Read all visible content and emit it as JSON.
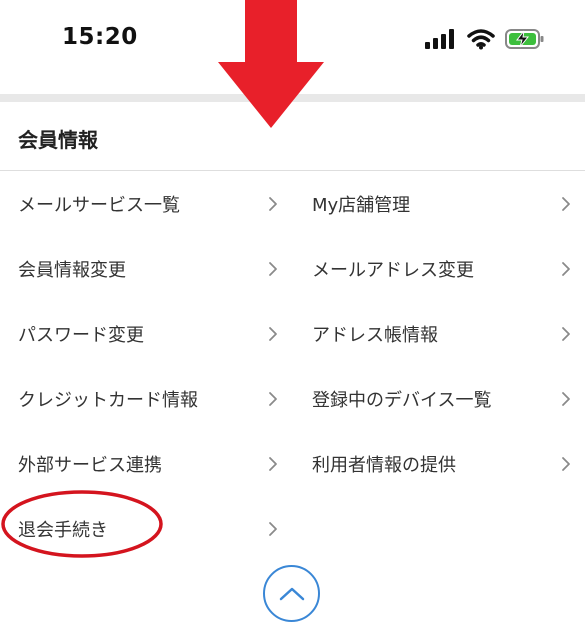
{
  "status_bar": {
    "time": "15:20",
    "icons": [
      "signal-icon",
      "wifi-icon",
      "battery-charging-icon"
    ],
    "battery_color": "#3dbf3d"
  },
  "section": {
    "title": "会員情報"
  },
  "menu": {
    "left": [
      {
        "label": "メールサービス一覧"
      },
      {
        "label": "会員情報変更"
      },
      {
        "label": "パスワード変更"
      },
      {
        "label": "クレジットカード情報"
      },
      {
        "label": "外部サービス連携"
      },
      {
        "label": "退会手続き"
      }
    ],
    "right": [
      {
        "label": "My店舗管理"
      },
      {
        "label": "メールアドレス変更"
      },
      {
        "label": "アドレス帳情報"
      },
      {
        "label": "登録中のデバイス一覧"
      },
      {
        "label": "利用者情報の提供"
      }
    ]
  },
  "annotations": {
    "arrow_color": "#e8202a",
    "circle_color": "#d4141e"
  },
  "scroll_top_button": {
    "icon": "chevron-up-icon",
    "color": "#3a87d6"
  }
}
